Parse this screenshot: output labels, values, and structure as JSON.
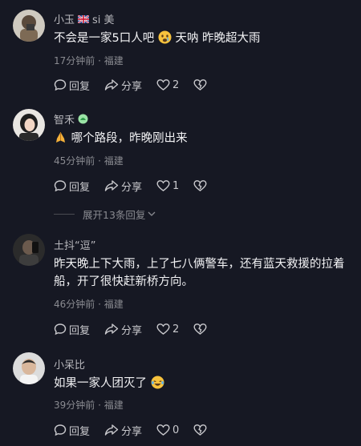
{
  "comments": [
    {
      "username": "小玉",
      "username_suffix": "si 美",
      "text_before": "不会是一家5口人吧",
      "text_after": " 天呐  昨晚超大雨",
      "time": "17分钟前 · 福建",
      "reply_label": "回复",
      "share_label": "分享",
      "like_count": "2"
    },
    {
      "username": "智禾",
      "text_after": " 哪个路段，昨晚刚出来",
      "time": "45分钟前 · 福建",
      "reply_label": "回复",
      "share_label": "分享",
      "like_count": "1"
    },
    {
      "username": "土抖“逗”",
      "text": "昨天晚上下大雨，上了七八俩警车，还有蓝天救援的拉着船，开了很快赶新桥方向。",
      "time": "46分钟前 · 福建",
      "reply_label": "回复",
      "share_label": "分享",
      "like_count": "2"
    },
    {
      "username": "小呆比",
      "text_before": "如果一家人团灭了",
      "time": "39分钟前 · 福建",
      "reply_label": "回复",
      "share_label": "分享",
      "like_count": "0"
    }
  ],
  "expand_replies": "展开13条回复",
  "colors": {
    "background": "#161823",
    "text": "#f2f2f4",
    "meta": "#8a8b91"
  }
}
